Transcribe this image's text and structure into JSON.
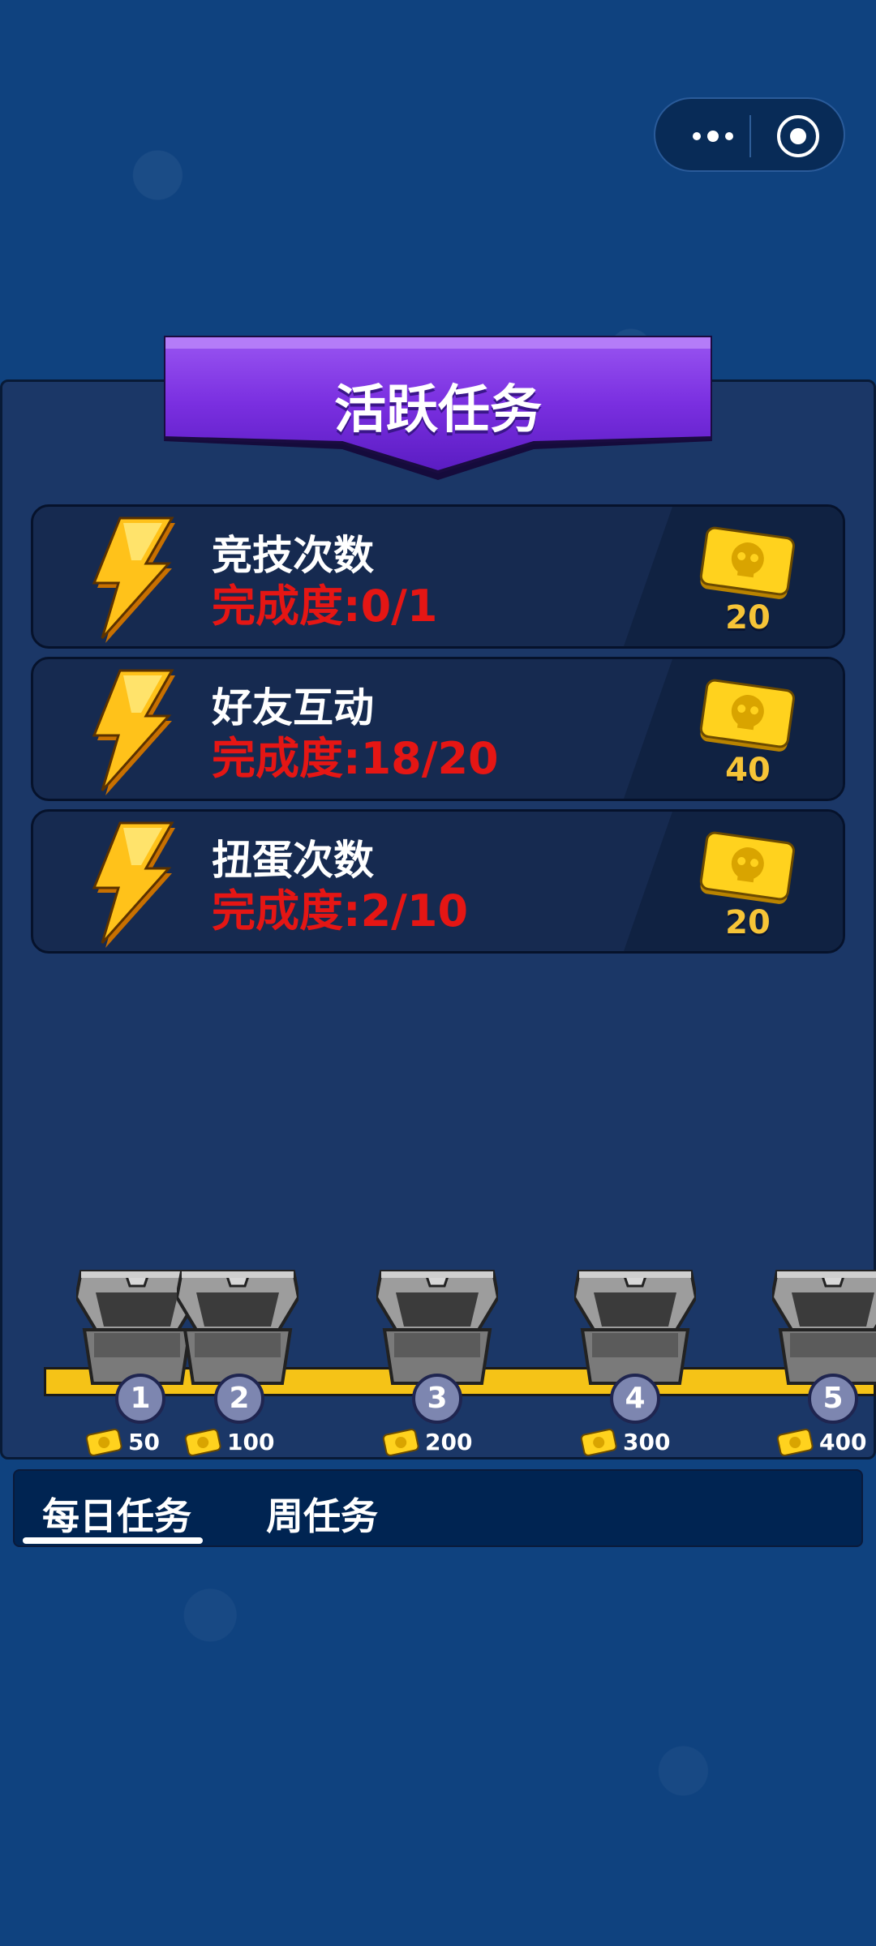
{
  "header": {
    "title": "活跃任务"
  },
  "tasks": [
    {
      "name": "竞技次数",
      "progress": "完成度:0/1",
      "reward": "20"
    },
    {
      "name": "好友互动",
      "progress": "完成度:18/20",
      "reward": "40"
    },
    {
      "name": "扭蛋次数",
      "progress": "完成度:2/10",
      "reward": "20"
    }
  ],
  "milestones": [
    {
      "number": "1",
      "reward": "50"
    },
    {
      "number": "2",
      "reward": "100"
    },
    {
      "number": "3",
      "reward": "200"
    },
    {
      "number": "4",
      "reward": "300"
    },
    {
      "number": "5",
      "reward": "400"
    }
  ],
  "tabs": [
    {
      "label": "每日任务",
      "selected": true
    },
    {
      "label": "周任务",
      "selected": false
    }
  ],
  "colors": {
    "background": "#0f427f",
    "panel": "#1b3767",
    "banner": "#7a2fe0",
    "progress_text": "#e51614",
    "reward_text": "#f6c437",
    "track": "#f5c317"
  },
  "icons": {
    "task": "lightning-bolt-icon",
    "reward": "skull-ticket-icon",
    "milestone": "treasure-chest-icon"
  }
}
